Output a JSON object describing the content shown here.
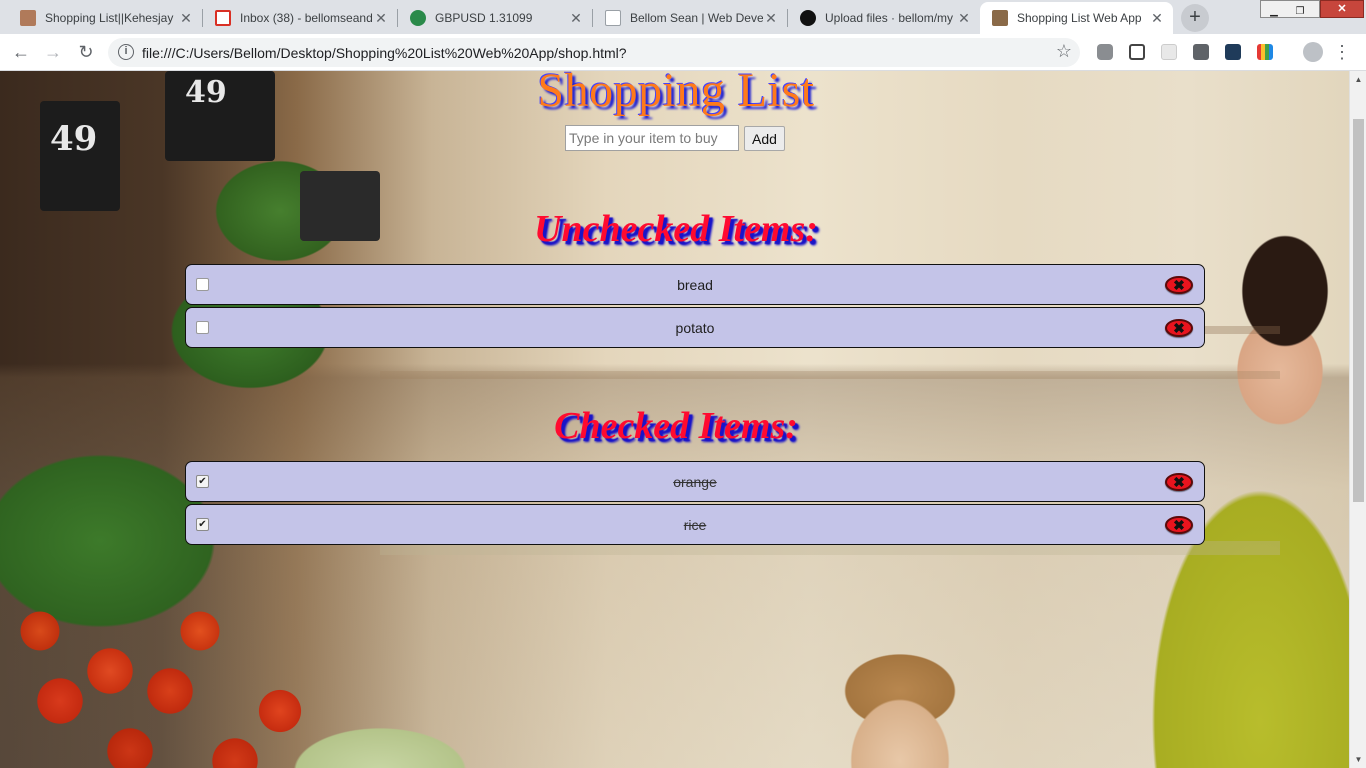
{
  "browser": {
    "tabs": [
      {
        "title": "Shopping List||Kehesjay",
        "favicon_color": "#b07a5a"
      },
      {
        "title": "Inbox (38) - bellomseand",
        "favicon_color": "#d93025"
      },
      {
        "title": "GBPUSD 1.31099",
        "favicon_color": "#2a8a4a"
      },
      {
        "title": "Bellom Sean | Web Deve",
        "favicon_color": "#9aa0a6"
      },
      {
        "title": "Upload files · bellom/my",
        "favicon_color": "#111111"
      },
      {
        "title": "Shopping List Web App",
        "favicon_color": "#8a6a48"
      }
    ],
    "close_glyph": "✕",
    "new_tab_glyph": "+",
    "back_glyph": "←",
    "forward_glyph": "→",
    "reload_glyph": "↻",
    "info_glyph": "i",
    "url": "file:///C:/Users/Bellom/Desktop/Shopping%20List%20Web%20App/shop.html?",
    "star_glyph": "☆",
    "menu_glyph": "⋮",
    "minimize_glyph": "▁",
    "maximize_glyph": "❐",
    "window_close_glyph": "✕"
  },
  "app": {
    "title": "Shopping List",
    "input_placeholder": "Type in your item to buy",
    "input_value": "",
    "add_label": "Add",
    "unchecked_heading": "Unchecked Items:",
    "checked_heading": "Checked Items:",
    "unchecked_items": [
      {
        "label": "bread",
        "checked": false
      },
      {
        "label": "potato",
        "checked": false
      }
    ],
    "checked_items": [
      {
        "label": "orange",
        "checked": true
      },
      {
        "label": "rice",
        "checked": true
      }
    ],
    "check_glyph": "✔",
    "delete_glyph": "✖",
    "delete_color": "#e8141e",
    "item_background": "#c4c4e8"
  },
  "background": {
    "price_signs": [
      "49",
      "49"
    ]
  }
}
